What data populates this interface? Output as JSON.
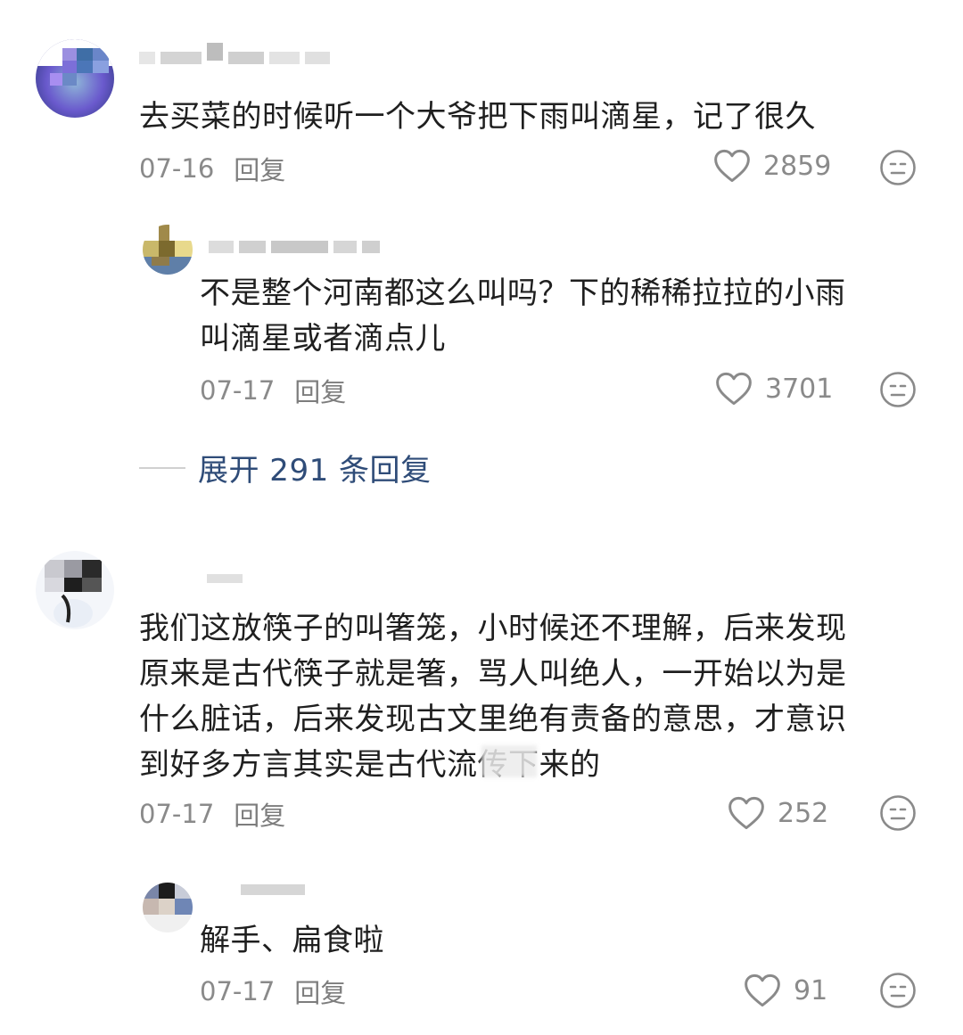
{
  "comments": [
    {
      "text": "去买菜的时候听一个大爷把下雨叫滴星，记了很久",
      "date": "07-16",
      "reply_label": "回复",
      "likes": "2859",
      "replies": [
        {
          "text": "不是整个河南都这么叫吗？下的稀稀拉拉的小雨\n叫滴星或者滴点儿",
          "date": "07-17",
          "reply_label": "回复",
          "likes": "3701"
        }
      ],
      "expand_label": "展开 291 条回复"
    },
    {
      "text": "我们这放筷子的叫箸笼，小时候还不理解，后来发现\n原来是古代筷子就是箸，骂人叫绝人，一开始以为是\n什么脏话，后来发现古文里绝有责备的意思，才意识\n到好多方言其实是古代流传下来的",
      "date": "07-17",
      "reply_label": "回复",
      "likes": "252",
      "replies": [
        {
          "text": "解手、扁食啦",
          "date": "07-17",
          "reply_label": "回复",
          "likes": "91"
        }
      ]
    }
  ],
  "icons": {
    "like": "heart-outline-icon",
    "emoji": "neutral-face-icon"
  },
  "colors": {
    "text": "#1f1f1f",
    "meta": "#8a8a8a",
    "expand": "#2f4c78",
    "icon": "#8a8a8a"
  }
}
